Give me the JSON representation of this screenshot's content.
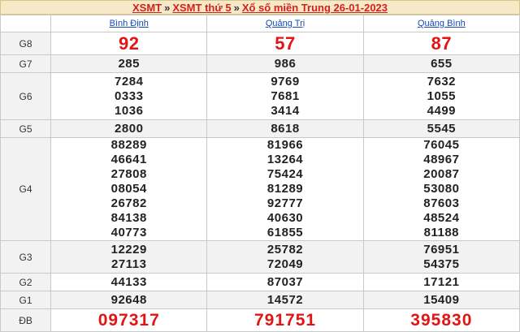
{
  "breadcrumb": {
    "items": [
      "XSMT",
      "XSMT thứ 5",
      "Xổ số miền Trung 26-01-2023"
    ],
    "separator": "»"
  },
  "provinces": [
    "Bình Định",
    "Quảng Trị",
    "Quảng Bình"
  ],
  "prizes": [
    {
      "label": "G8",
      "values": [
        [
          "92"
        ],
        [
          "57"
        ],
        [
          "87"
        ]
      ]
    },
    {
      "label": "G7",
      "values": [
        [
          "285"
        ],
        [
          "986"
        ],
        [
          "655"
        ]
      ]
    },
    {
      "label": "G6",
      "values": [
        [
          "7284",
          "0333",
          "1036"
        ],
        [
          "9769",
          "7681",
          "3414"
        ],
        [
          "7632",
          "1055",
          "4499"
        ]
      ]
    },
    {
      "label": "G5",
      "values": [
        [
          "2800"
        ],
        [
          "8618"
        ],
        [
          "5545"
        ]
      ]
    },
    {
      "label": "G4",
      "values": [
        [
          "88289",
          "46641",
          "27808",
          "08054",
          "26782",
          "84138",
          "40773"
        ],
        [
          "81966",
          "13264",
          "75424",
          "81289",
          "92777",
          "40630",
          "61855"
        ],
        [
          "76045",
          "48967",
          "20087",
          "53080",
          "87603",
          "48524",
          "81188"
        ]
      ]
    },
    {
      "label": "G3",
      "values": [
        [
          "12229",
          "27113"
        ],
        [
          "25782",
          "72049"
        ],
        [
          "76951",
          "54375"
        ]
      ]
    },
    {
      "label": "G2",
      "values": [
        [
          "44133"
        ],
        [
          "87037"
        ],
        [
          "17121"
        ]
      ]
    },
    {
      "label": "G1",
      "values": [
        [
          "92648"
        ],
        [
          "14572"
        ],
        [
          "15409"
        ]
      ]
    },
    {
      "label": "ĐB",
      "values": [
        [
          "097317"
        ],
        [
          "791751"
        ],
        [
          "395830"
        ]
      ]
    }
  ]
}
